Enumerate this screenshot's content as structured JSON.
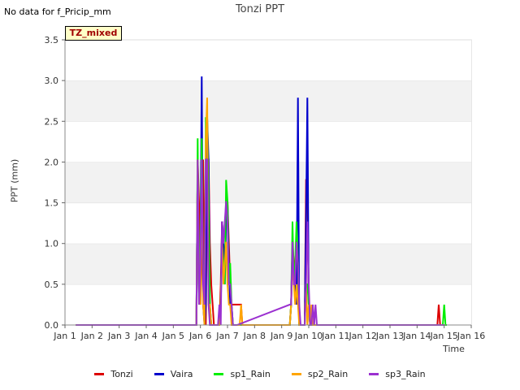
{
  "header": {
    "no_data_note": "No data for f_Pricip_mm",
    "badge": "TZ_mixed"
  },
  "chart_data": {
    "type": "line",
    "title": "Tonzi PPT",
    "xlabel": "Time",
    "ylabel": "PPT (mm)",
    "xlim": [
      1,
      16
    ],
    "ylim": [
      0,
      3.5
    ],
    "x_ticks": [
      1,
      2,
      3,
      4,
      5,
      6,
      7,
      8,
      9,
      10,
      11,
      12,
      13,
      14,
      15,
      16
    ],
    "x_tick_labels": [
      "Jan 1",
      "Jan 2",
      "Jan 3",
      "Jan 4",
      "Jan 5",
      "Jan 6",
      "Jan 7",
      "Jan 8",
      "Jan 9",
      "Jan 10",
      "Jan 11",
      "Jan 12",
      "Jan 13",
      "Jan 14",
      "Jan 15",
      "Jan 16"
    ],
    "y_ticks": [
      0,
      0.5,
      1.0,
      1.5,
      2.0,
      2.5,
      3.0,
      3.5
    ],
    "y_tick_labels": [
      "0.0",
      "0.5",
      "1.0",
      "1.5",
      "2.0",
      "2.5",
      "3.0",
      "3.5"
    ],
    "grid": "horizontal bands",
    "legend_position": "bottom",
    "series": [
      {
        "name": "Tonzi",
        "color": "#dd0000",
        "x": [
          1.4,
          5.85,
          5.9,
          5.95,
          6.0,
          6.05,
          6.1,
          6.15,
          6.2,
          6.25,
          6.3,
          6.35,
          6.4,
          6.45,
          6.5,
          6.55,
          6.6,
          6.65,
          6.7,
          6.75,
          6.8,
          6.85,
          6.9,
          6.95,
          7.0,
          7.05,
          7.1,
          7.15,
          7.2,
          7.25,
          7.3,
          7.35,
          7.4,
          7.45,
          7.5,
          7.55,
          7.6,
          7.65,
          7.7,
          9.3,
          9.35,
          9.4,
          9.45,
          9.5,
          9.55,
          9.6,
          9.65,
          9.7,
          9.75,
          9.8,
          9.85,
          9.9,
          9.95,
          10.0,
          10.05,
          10.1,
          10.15,
          10.2,
          10.25,
          14.75,
          14.8,
          14.85,
          14.9,
          15.0
        ],
        "y": [
          0,
          0,
          2.03,
          1.5,
          0.25,
          1.03,
          2.03,
          0.25,
          0,
          2.03,
          2.03,
          1.0,
          0.5,
          0.25,
          0,
          0,
          0,
          0,
          0,
          0.5,
          1.27,
          1.0,
          0.75,
          1.27,
          1.52,
          1.0,
          0.5,
          0.25,
          0.25,
          0.25,
          0.25,
          0.25,
          0.25,
          0.25,
          0.25,
          0,
          0,
          0,
          0,
          0,
          0.25,
          1.02,
          0.75,
          0.5,
          0.76,
          0.76,
          0,
          0,
          0,
          0,
          0,
          1.78,
          1.78,
          0.25,
          0,
          0,
          0,
          0,
          0,
          0,
          0.25,
          0,
          0,
          0
        ]
      },
      {
        "name": "Vaira",
        "color": "#0000cc",
        "x": [
          1.4,
          5.85,
          5.9,
          5.95,
          6.0,
          6.05,
          6.1,
          6.15,
          6.2,
          6.25,
          6.3,
          6.35,
          6.4,
          6.45,
          6.5,
          6.55,
          6.6,
          6.65,
          6.7,
          6.75,
          6.8,
          6.85,
          6.9,
          6.95,
          7.0,
          7.05,
          7.1,
          7.15,
          7.2,
          7.25,
          7.3,
          9.3,
          9.35,
          9.4,
          9.45,
          9.5,
          9.55,
          9.6,
          9.65,
          9.7,
          9.75,
          9.8,
          9.85,
          9.9,
          9.95,
          10.0,
          10.05,
          10.1,
          10.15,
          15.0
        ],
        "y": [
          0,
          0,
          2.03,
          0.25,
          1.0,
          3.05,
          0.25,
          0,
          0.25,
          2.54,
          2.03,
          0.25,
          0,
          0,
          0,
          0,
          0,
          0,
          0,
          0.25,
          1.27,
          1.0,
          0.5,
          1.27,
          1.52,
          0.75,
          0.25,
          0.25,
          0,
          0,
          0,
          0,
          0.25,
          1.02,
          0.5,
          0.5,
          0.25,
          2.79,
          0,
          0,
          0,
          0,
          0,
          1.27,
          2.79,
          0.25,
          0,
          0,
          0,
          0
        ]
      },
      {
        "name": "sp1_Rain",
        "color": "#00ee00",
        "x": [
          1.4,
          5.85,
          5.9,
          5.95,
          6.0,
          6.05,
          6.1,
          6.15,
          6.2,
          6.25,
          6.3,
          6.35,
          6.4,
          6.45,
          6.5,
          6.55,
          6.6,
          6.65,
          6.7,
          6.75,
          6.8,
          6.85,
          6.9,
          6.95,
          7.0,
          7.05,
          7.1,
          7.15,
          7.2,
          7.25,
          7.3,
          9.3,
          9.35,
          9.4,
          9.45,
          9.5,
          9.55,
          9.6,
          9.65,
          9.7,
          9.75,
          9.8,
          9.85,
          9.9,
          9.95,
          10.0,
          10.05,
          14.8,
          14.85,
          14.9,
          14.95,
          15.0,
          15.05,
          15.1
        ],
        "y": [
          0,
          0,
          2.29,
          0.25,
          1.0,
          2.29,
          0.5,
          0.25,
          2.54,
          2.54,
          1.5,
          0.25,
          0,
          0,
          0,
          0,
          0,
          0,
          0,
          0.25,
          1.0,
          0.76,
          0.5,
          1.78,
          1.52,
          0.5,
          0.76,
          0.25,
          0,
          0,
          0,
          0,
          0.25,
          1.27,
          0.5,
          0.76,
          1.27,
          0.76,
          0,
          0,
          0,
          0,
          0,
          0.5,
          0.5,
          0.25,
          0,
          0,
          0,
          0,
          0,
          0.25,
          0,
          0
        ]
      },
      {
        "name": "sp2_Rain",
        "color": "#ffa500",
        "x": [
          1.4,
          5.85,
          5.9,
          5.95,
          6.0,
          6.05,
          6.1,
          6.15,
          6.2,
          6.25,
          6.3,
          6.35,
          6.4,
          6.45,
          6.5,
          6.55,
          6.6,
          6.65,
          6.7,
          6.75,
          6.8,
          6.85,
          6.9,
          6.95,
          7.0,
          7.05,
          7.1,
          7.15,
          7.2,
          7.25,
          7.3,
          7.35,
          7.4,
          7.45,
          7.5,
          7.55,
          7.6,
          7.65,
          9.3,
          9.35,
          9.4,
          9.45,
          9.5,
          9.55,
          9.6,
          9.65,
          9.7,
          9.75,
          9.8,
          9.85,
          9.9,
          9.95,
          10.0,
          10.05,
          10.1,
          10.15,
          10.2,
          10.25,
          10.3
        ],
        "y": [
          0,
          0,
          2.03,
          0.5,
          0.25,
          2.03,
          0.25,
          0,
          2.29,
          2.79,
          0.25,
          0.25,
          0,
          0,
          0,
          0,
          0,
          0,
          0,
          0.25,
          1.02,
          0.5,
          0.76,
          1.02,
          0.5,
          0.25,
          0.25,
          0,
          0,
          0,
          0,
          0,
          0,
          0,
          0.25,
          0,
          0,
          0,
          0,
          0.25,
          0.76,
          0.5,
          0.25,
          0.5,
          0.25,
          0,
          0,
          0,
          0,
          0,
          0.5,
          0,
          0.25,
          0,
          0.25,
          0,
          0,
          0,
          0
        ]
      },
      {
        "name": "sp3_Rain",
        "color": "#9b30d0",
        "x": [
          1.4,
          5.85,
          5.9,
          5.95,
          6.0,
          6.05,
          6.1,
          6.15,
          6.2,
          6.25,
          6.3,
          6.35,
          6.4,
          6.45,
          6.5,
          6.55,
          6.6,
          6.65,
          6.7,
          6.75,
          6.8,
          6.85,
          6.9,
          6.95,
          7.0,
          7.05,
          7.1,
          7.15,
          7.2,
          7.25,
          7.3,
          7.35,
          9.3,
          9.35,
          9.4,
          9.45,
          9.5,
          9.55,
          9.6,
          9.65,
          9.7,
          9.75,
          9.8,
          9.85,
          9.9,
          9.95,
          10.0,
          10.05,
          10.1,
          10.15,
          10.2,
          10.25,
          10.3,
          10.35,
          15.0
        ],
        "y": [
          0,
          0,
          2.03,
          0.25,
          0.75,
          2.03,
          0.5,
          0.25,
          2.03,
          2.03,
          0.25,
          0,
          0,
          0,
          0,
          0,
          0,
          0,
          0.25,
          0,
          1.27,
          1.0,
          1.27,
          1.52,
          1.27,
          0.5,
          0.5,
          0.25,
          0,
          0,
          0,
          0,
          0.25,
          0.25,
          1.02,
          0.5,
          0.5,
          1.02,
          0.76,
          0.25,
          0,
          0,
          0,
          0,
          0.5,
          1.27,
          0.5,
          0,
          0,
          0.25,
          0,
          0.25,
          0,
          0,
          0
        ]
      }
    ]
  }
}
